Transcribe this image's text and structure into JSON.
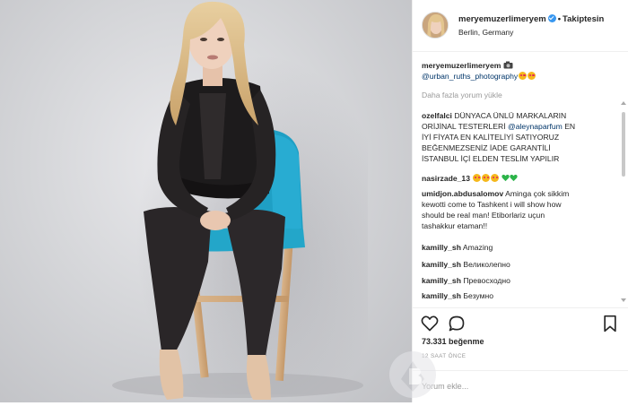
{
  "post": {
    "username": "meryemuzerlimeryem",
    "separator": "•",
    "follow_label": "Takiptesin",
    "location": "Berlin, Germany"
  },
  "caption": {
    "username": "meryemuzerlimeryem",
    "mention": "@urban_ruths_photography"
  },
  "load_more_label": "Daha fazla yorum yükle",
  "comments": [
    {
      "user": "ozelfalci",
      "text_lines": [
        "DÜNYACA ÜNLÜ MARKALARIN",
        "ORİJİNAL TESTERLERİ",
        "İYİ FİYATA EN KALİTELİYİ SATIYORUZ",
        "BEĞENMEZSENİZ İADE GARANTİLİ",
        "İSTANBUL İÇİ ELDEN TESLİM YAPILIR"
      ],
      "mention": "@aleynaparfum",
      "mention_after": "EN"
    },
    {
      "user": "nasirzade_13"
    },
    {
      "user": "umidjon.abdusalomov",
      "text_lines": [
        "Aminga çok sikkim",
        "kewotti come to Tashkent i will show how",
        "should be real man! Etiborlariz uçun",
        "tashakkur etaman!!"
      ]
    },
    {
      "user": "kamilly_sh",
      "text": "Amazing"
    },
    {
      "user": "kamilly_sh",
      "text": "Великолепно"
    },
    {
      "user": "kamilly_sh",
      "text": "Превосходно"
    },
    {
      "user": "kamilly_sh",
      "text": "Безумно"
    }
  ],
  "actions": {
    "like_icon": "heart-icon",
    "comment_icon": "comment-icon",
    "save_icon": "bookmark-icon"
  },
  "likes_count": "73.331",
  "likes_label": "beğenme",
  "time_ago": "12 SAAT ÖNCE",
  "add_comment_placeholder": "Yorum ekle...",
  "colors": {
    "link": "#003569",
    "verified": "#3897f0",
    "muted": "#999999",
    "chair_seat": "#23a6c9"
  }
}
